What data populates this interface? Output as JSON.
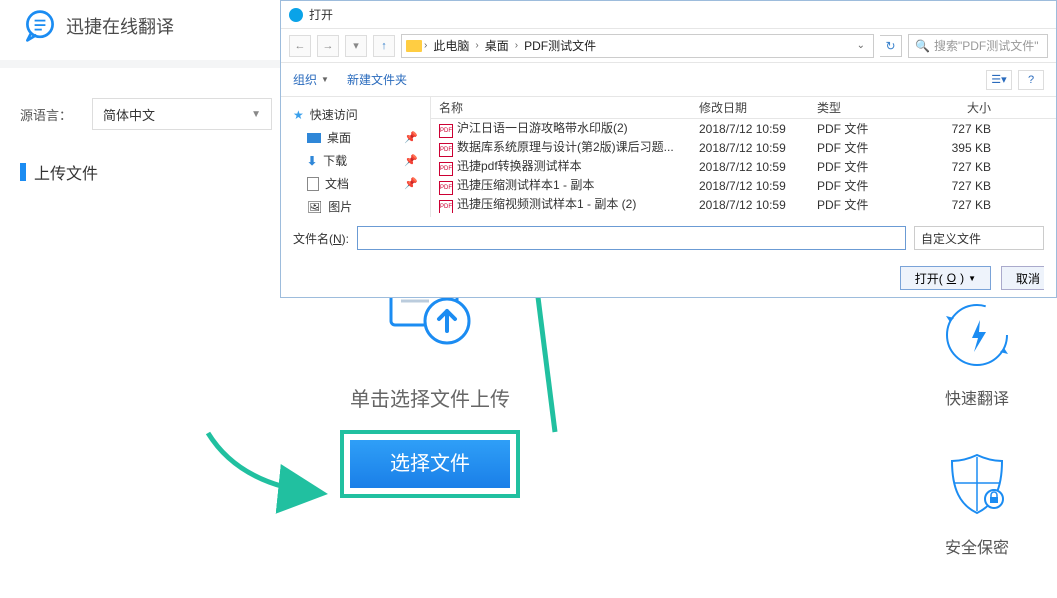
{
  "brand": {
    "name": "迅捷在线翻译"
  },
  "lang": {
    "label": "源语言：",
    "value": "简体中文"
  },
  "upload": {
    "section_title": "上传文件",
    "hint": "单击选择文件上传",
    "choose_btn": "选择文件"
  },
  "rail": {
    "fast": "快速翻译",
    "secure": "安全保密"
  },
  "dialog": {
    "title": "打开",
    "crumbs": [
      "此电脑",
      "桌面",
      "PDF测试文件"
    ],
    "search_placeholder": "搜索\"PDF测试文件\"",
    "organize": "组织",
    "new_folder": "新建文件夹",
    "sidebar": {
      "quick_access": "快速访问",
      "desktop": "桌面",
      "downloads": "下载",
      "documents": "文档",
      "pictures": "图片"
    },
    "columns": {
      "name": "名称",
      "date": "修改日期",
      "type": "类型",
      "size": "大小"
    },
    "files": [
      {
        "name": "沪江日语一日游攻略带水印版(2)",
        "date": "2018/7/12 10:59",
        "type": "PDF 文件",
        "size": "727 KB"
      },
      {
        "name": "数据库系统原理与设计(第2版)课后习题...",
        "date": "2018/7/12 10:59",
        "type": "PDF 文件",
        "size": "395 KB"
      },
      {
        "name": "迅捷pdf转换器测试样本",
        "date": "2018/7/12 10:59",
        "type": "PDF 文件",
        "size": "727 KB"
      },
      {
        "name": "迅捷压缩测试样本1 - 副本",
        "date": "2018/7/12 10:59",
        "type": "PDF 文件",
        "size": "727 KB"
      },
      {
        "name": "迅捷压缩视频测试样本1 - 副本 (2)",
        "date": "2018/7/12 10:59",
        "type": "PDF 文件",
        "size": "727 KB"
      }
    ],
    "filename_label_pre": "文件名(",
    "filename_label_u": "N",
    "filename_label_post": "):",
    "filter": "自定义文件",
    "open_btn_pre": "打开(",
    "open_btn_u": "O",
    "open_btn_post": ")",
    "cancel_btn": "取消"
  }
}
